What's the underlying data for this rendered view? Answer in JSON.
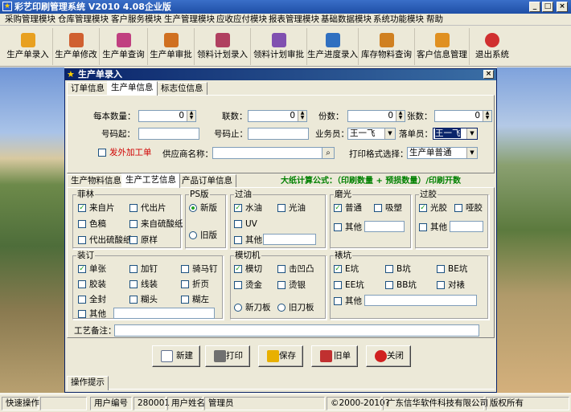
{
  "window": {
    "title": "彩艺印刷管理系统   V2010 4.08企业版",
    "min": "_",
    "max": "□",
    "close": "×"
  },
  "menu": [
    "采购管理模块",
    "仓库管理模块",
    "客户服务模块",
    "生产管理模块",
    "应收应付模块",
    "报表管理模块",
    "基础数据模块",
    "系统功能模块",
    "帮助"
  ],
  "toolbar": [
    {
      "label": "生产单录入",
      "icon": "production-entry-icon",
      "color": "#e8a020"
    },
    {
      "label": "生产单修改",
      "icon": "production-edit-icon",
      "color": "#d06030"
    },
    {
      "label": "生产单查询",
      "icon": "production-query-icon",
      "color": "#c04080"
    },
    {
      "label": "生产单审批",
      "icon": "production-approve-icon",
      "color": "#d07020"
    },
    {
      "label": "领料计划录入",
      "icon": "material-plan-entry-icon",
      "color": "#b04060"
    },
    {
      "label": "领料计划审批",
      "icon": "material-plan-approve-icon",
      "color": "#8050b0"
    },
    {
      "label": "生产进度录入",
      "icon": "progress-entry-icon",
      "color": "#3070c0"
    },
    {
      "label": "库存物料查询",
      "icon": "inventory-query-icon",
      "color": "#d08020"
    },
    {
      "label": "客户信息管理",
      "icon": "customer-info-icon",
      "color": "#e09020"
    },
    {
      "label": "退出系统",
      "icon": "exit-icon",
      "color": "#d03030"
    }
  ],
  "dialog": {
    "title": "生产单录入",
    "close": "×",
    "tabs": [
      "订单信息",
      "生产单信息",
      "标志位信息"
    ],
    "fields": {
      "qty_label": "每本数量：",
      "qty_value": "0",
      "copies_label": "联数：",
      "copies_value": "0",
      "parts_label": "份数：",
      "parts_value": "0",
      "sheets_label": "张数：",
      "sheets_value": "0",
      "num_start_label": "号码起：",
      "num_start_value": "",
      "num_end_label": "号码止：",
      "num_end_value": "",
      "salesman_label": "业务员：",
      "salesman_value": "王一飞",
      "filler_label": "落单员：",
      "filler_value": "王一飞",
      "outsource_label": "发外加工单",
      "supplier_label": "供应商名称：",
      "supplier_value": "",
      "print_format_label": "打印格式选择：",
      "print_format_value": "生产单普通"
    },
    "subtabs": [
      "生产物料信息",
      "生产工艺信息",
      "产品订单信息"
    ],
    "formula": "大纸计算公式：（印刷数量 + 预损数量）/印刷开数",
    "groups": {
      "paper": {
        "title": "菲林",
        "items": [
          {
            "label": "来自片",
            "checked": true
          },
          {
            "label": "代出片",
            "checked": false
          },
          {
            "label": "色稿",
            "checked": false
          },
          {
            "label": "来自硫酸纸",
            "checked": false
          },
          {
            "label": "代出硫酸纸",
            "checked": false
          },
          {
            "label": "原样",
            "checked": false
          }
        ]
      },
      "ps": {
        "title": "PS版",
        "items": [
          {
            "label": "新版",
            "checked": true
          },
          {
            "label": "旧版",
            "checked": false
          }
        ]
      },
      "oil": {
        "title": "过油",
        "items": [
          {
            "label": "水油",
            "checked": true
          },
          {
            "label": "光油",
            "checked": false
          },
          {
            "label": "UV",
            "checked": false
          },
          {
            "label": "其他",
            "checked": false
          }
        ]
      },
      "polish": {
        "title": "磨光",
        "items": [
          {
            "label": "普通",
            "checked": true
          },
          {
            "label": "吸塑",
            "checked": false
          },
          {
            "label": "其他",
            "checked": false
          }
        ]
      },
      "laminate": {
        "title": "过胶",
        "items": [
          {
            "label": "光胶",
            "checked": true
          },
          {
            "label": "哑胶",
            "checked": false
          },
          {
            "label": "其他",
            "checked": false
          }
        ]
      },
      "binding": {
        "title": "装订",
        "items": [
          {
            "label": "单张",
            "checked": true
          },
          {
            "label": "加钉",
            "checked": false
          },
          {
            "label": "骑马钉",
            "checked": false
          },
          {
            "label": "胶装",
            "checked": false
          },
          {
            "label": "线装",
            "checked": false
          },
          {
            "label": "折页",
            "checked": false
          },
          {
            "label": "全封",
            "checked": false
          },
          {
            "label": "糊头",
            "checked": false
          },
          {
            "label": "糊左",
            "checked": false
          },
          {
            "label": "其他",
            "checked": false
          }
        ]
      },
      "diecut": {
        "title": "模切机",
        "items": [
          {
            "label": "模切",
            "checked": true
          },
          {
            "label": "击凹凸",
            "checked": false
          },
          {
            "label": "烫金",
            "checked": false
          },
          {
            "label": "烫银",
            "checked": false
          },
          {
            "label": "新刀板",
            "checked": false
          },
          {
            "label": "旧刀板",
            "checked": false
          }
        ]
      },
      "flute": {
        "title": "裱坑",
        "items": [
          {
            "label": "E坑",
            "checked": true
          },
          {
            "label": "B坑",
            "checked": false
          },
          {
            "label": "BE坑",
            "checked": false
          },
          {
            "label": "EE坑",
            "checked": false
          },
          {
            "label": "BB坑",
            "checked": false
          },
          {
            "label": "对裱",
            "checked": false
          },
          {
            "label": "其他",
            "checked": false
          }
        ]
      }
    },
    "remark_label": "工艺备注：",
    "buttons": [
      "新建",
      "打印",
      "保存",
      "旧单",
      "关闭"
    ],
    "hint_tab": "操作提示"
  },
  "status": {
    "quick": "快速操作",
    "user_no_label": "用户编号",
    "user_no": "280001",
    "user_name_label": "用户姓名",
    "user_name": "管理员",
    "copyright": "©2000-2010?",
    "company": "广东信华软件科技有限公司",
    "rights": "版权所有"
  }
}
